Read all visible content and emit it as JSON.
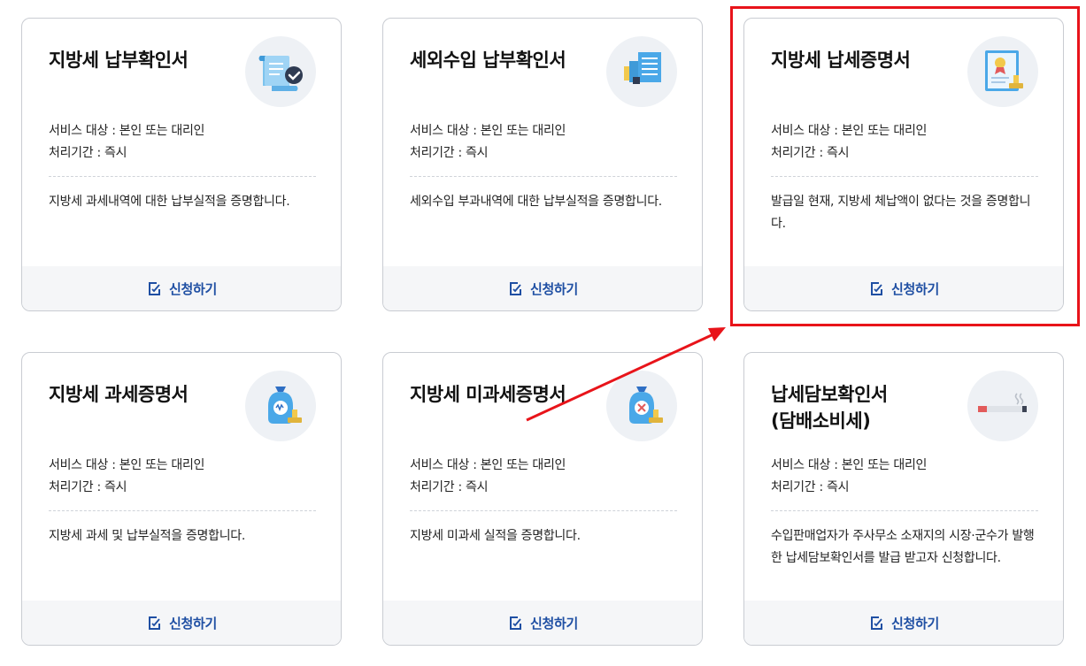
{
  "cards": [
    {
      "title": "지방세 납부확인서",
      "target": "서비스 대상 : 본인 또는 대리인",
      "period": "처리기간 : 즉시",
      "desc": "지방세 과세내역에 대한 납부실적을 증명합니다.",
      "apply_label": "신청하기",
      "icon": "scroll-check-icon"
    },
    {
      "title": "세외수입 납부확인서",
      "target": "서비스 대상 : 본인 또는 대리인",
      "period": "처리기간 : 즉시",
      "desc": "세외수입 부과내역에 대한 납부실적을 증명합니다.",
      "apply_label": "신청하기",
      "icon": "building-document-icon"
    },
    {
      "title": "지방세 납세증명서",
      "target": "서비스 대상 : 본인 또는 대리인",
      "period": "처리기간 : 즉시",
      "desc": "발급일 현재, 지방세 체납액이 없다는 것을 증명합니다.",
      "apply_label": "신청하기",
      "icon": "certificate-stamp-icon"
    },
    {
      "title": "지방세 과세증명서",
      "target": "서비스 대상 : 본인 또는 대리인",
      "period": "처리기간 : 즉시",
      "desc": "지방세 과세 및 납부실적을 증명합니다.",
      "apply_label": "신청하기",
      "icon": "money-bag-stamp-icon"
    },
    {
      "title": "지방세 미과세증명서",
      "target": "서비스 대상 : 본인 또는 대리인",
      "period": "처리기간 : 즉시",
      "desc": "지방세 미과세 실적을 증명합니다.",
      "apply_label": "신청하기",
      "icon": "money-bag-x-stamp-icon"
    },
    {
      "title": "납세담보확인서\n(담배소비세)",
      "target": "서비스 대상 : 본인 또는 대리인",
      "period": "처리기간 : 즉시",
      "desc": "수입판매업자가 주사무소 소재지의 시장·군수가 발행한 납세담보확인서를 발급 받고자 신청합니다.",
      "apply_label": "신청하기",
      "icon": "cigarette-icon"
    }
  ],
  "colors": {
    "accent": "#1f4fa3",
    "highlight": "#e8141a",
    "footer_bg": "#f5f6f8"
  }
}
